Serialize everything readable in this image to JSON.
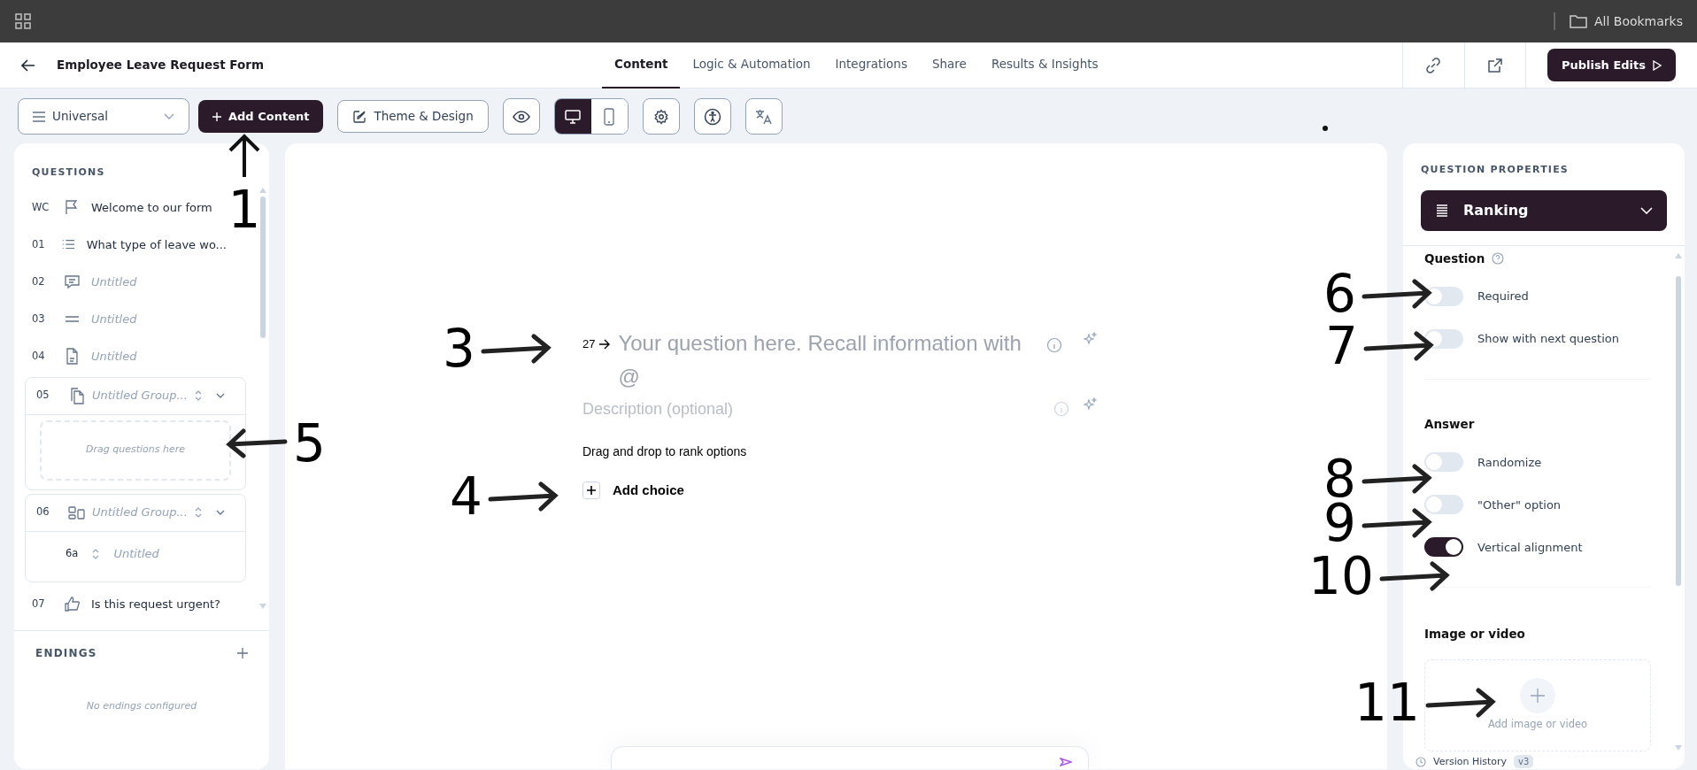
{
  "browser_bar": {
    "bookmarks_label": "All Bookmarks"
  },
  "header": {
    "title": "Employee Leave Request Form",
    "tabs": [
      {
        "label": "Content",
        "selected": true
      },
      {
        "label": "Logic & Automation",
        "selected": false
      },
      {
        "label": "Integrations",
        "selected": false
      },
      {
        "label": "Share",
        "selected": false
      },
      {
        "label": "Results & Insights",
        "selected": false
      }
    ],
    "publish_button": "Publish Edits"
  },
  "toolbar": {
    "audience": "Universal",
    "add_button": "Add Content",
    "theme_button": "Theme & Design",
    "devices": [
      {
        "kind": "desktop",
        "selected": true
      },
      {
        "kind": "mobile",
        "selected": false
      }
    ]
  },
  "questions_panel": {
    "title": "QUESTIONS",
    "items": [
      {
        "kind": "question",
        "number": "WC",
        "title": "Welcome to our form",
        "is_placeholder": false
      },
      {
        "kind": "question",
        "number": "01",
        "title": "What type of leave wo...",
        "is_placeholder": false
      },
      {
        "kind": "question",
        "number": "02",
        "title": "Untitled",
        "is_placeholder": true
      },
      {
        "kind": "question",
        "number": "03",
        "title": "Untitled",
        "is_placeholder": true
      },
      {
        "kind": "question",
        "number": "04",
        "title": "Untitled",
        "is_placeholder": true
      },
      {
        "kind": "group",
        "number": "05",
        "title": "Untitled Group...",
        "is_placeholder": true,
        "drop_hint": "Drag questions here"
      },
      {
        "kind": "group",
        "number": "06",
        "title": "Untitled Group...",
        "is_placeholder": true,
        "children": [
          {
            "number": "6a",
            "title": "Untitled",
            "is_placeholder": true
          }
        ]
      },
      {
        "kind": "question",
        "number": "07",
        "title": "Is this request urgent?",
        "is_placeholder": false
      }
    ],
    "endings_title": "ENDINGS",
    "endings_empty": "No endings configured"
  },
  "editor": {
    "number": "27",
    "question_placeholder": "Your question here. Recall information with @",
    "description_placeholder": "Description (optional)",
    "hint": "Drag and drop to rank options",
    "add_choice": "Add choice"
  },
  "properties_panel": {
    "title": "QUESTION PROPERTIES",
    "question_type": "Ranking",
    "sections": [
      {
        "title": "Question",
        "toggles": [
          {
            "label": "Required",
            "on": false
          },
          {
            "label": "Show with next question",
            "on": false
          }
        ]
      },
      {
        "title": "Answer",
        "toggles": [
          {
            "label": "Randomize",
            "on": false
          },
          {
            "label": "\"Other\" option",
            "on": false
          },
          {
            "label": "Vertical alignment",
            "on": true
          }
        ]
      }
    ],
    "media_title": "Image or video",
    "media_label": "Add image or video",
    "version_history": "Version History",
    "version_badge": "v3"
  },
  "callouts": [
    {
      "number": "1"
    },
    {
      "number": "3"
    },
    {
      "number": "4"
    },
    {
      "number": "5"
    },
    {
      "number": "6"
    },
    {
      "number": "7"
    },
    {
      "number": "8"
    },
    {
      "number": "9"
    },
    {
      "number": "10"
    },
    {
      "number": "11"
    }
  ]
}
